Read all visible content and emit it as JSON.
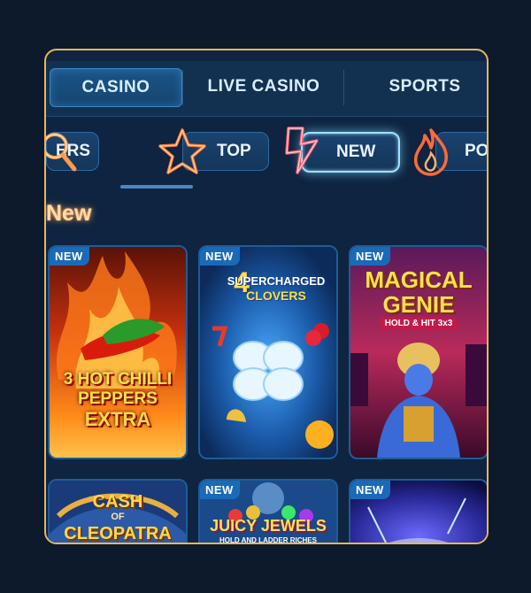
{
  "tabs": [
    {
      "label": "CASINO",
      "active": true
    },
    {
      "label": "LIVE CASINO",
      "active": false
    },
    {
      "label": "SPORTS",
      "active": false
    }
  ],
  "categories": [
    {
      "label": "ERS",
      "icon": "search-icon",
      "active": false
    },
    {
      "label": "TOP",
      "icon": "star-icon",
      "active": false
    },
    {
      "label": "NEW",
      "icon": "lightning-icon",
      "active": true
    },
    {
      "label": "PO",
      "icon": "flame-icon",
      "active": false
    }
  ],
  "section": {
    "title": "New"
  },
  "games": [
    {
      "badge": "NEW",
      "title_line1": "3 HOT CHILLI",
      "title_line2": "PEPPERS",
      "title_line3": "EXTRA"
    },
    {
      "badge": "NEW",
      "title_line1": "4",
      "title_line2": "SUPERCHARGED",
      "title_line3": "CLOVERS"
    },
    {
      "badge": "NEW",
      "title_line1": "MAGICAL",
      "title_line2": "GENIE",
      "title_line3": "HOLD & HIT 3x3"
    },
    {
      "badge": "",
      "title_line1": "CASH",
      "title_line2": "OF",
      "title_line3": "CLEOPATRA"
    },
    {
      "badge": "NEW",
      "title_line1": "JUICY JEWELS",
      "title_line2": "HOLD AND LADDER RICHES",
      "title_line3": ""
    },
    {
      "badge": "NEW",
      "title_line1": "",
      "title_line2": "",
      "title_line3": ""
    }
  ],
  "colors": {
    "background": "#0c1a2c",
    "frame_border": "#e6b85c",
    "tab_active": "#1b5487",
    "badge": "#1a6ab8",
    "section_title_glow": "#ff9a4a"
  }
}
